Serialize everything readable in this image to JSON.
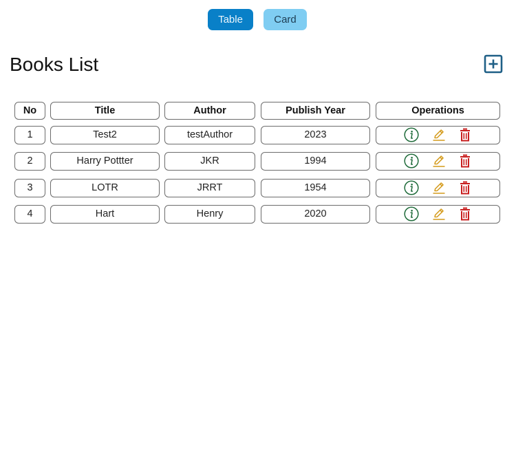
{
  "view_toggle": {
    "table_label": "Table",
    "card_label": "Card"
  },
  "header": {
    "title": "Books List",
    "add_icon": "plus-square-icon"
  },
  "table": {
    "columns": [
      "No",
      "Title",
      "Author",
      "Publish Year",
      "Operations"
    ],
    "rows": [
      {
        "no": "1",
        "title": "Test2",
        "author": "testAuthor",
        "year": "2023"
      },
      {
        "no": "2",
        "title": "Harry Pottter",
        "author": "JKR",
        "year": "1994"
      },
      {
        "no": "3",
        "title": "LOTR",
        "author": "JRRT",
        "year": "1954"
      },
      {
        "no": "4",
        "title": "Hart",
        "author": "Henry",
        "year": "2020"
      }
    ],
    "operation_icons": [
      "info-circle-icon",
      "edit-pencil-icon",
      "delete-trash-icon"
    ]
  },
  "colors": {
    "table_button": "#0980c8",
    "card_button": "#7fcdf2",
    "add_icon": "#1e5f86",
    "info_icon": "#1f6b3a",
    "edit_icon": "#d49a1a",
    "delete_icon": "#c81e1e"
  }
}
